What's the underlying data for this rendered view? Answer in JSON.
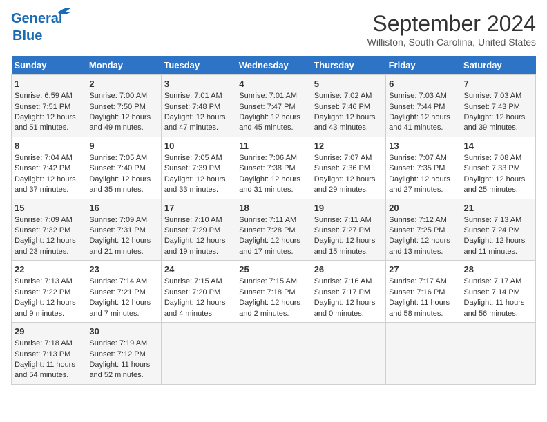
{
  "logo": {
    "line1": "General",
    "line2": "Blue"
  },
  "title": "September 2024",
  "location": "Williston, South Carolina, United States",
  "headers": [
    "Sunday",
    "Monday",
    "Tuesday",
    "Wednesday",
    "Thursday",
    "Friday",
    "Saturday"
  ],
  "weeks": [
    [
      {
        "day": "1",
        "sunrise": "6:59 AM",
        "sunset": "7:51 PM",
        "daylight": "12 hours and 51 minutes."
      },
      {
        "day": "2",
        "sunrise": "7:00 AM",
        "sunset": "7:50 PM",
        "daylight": "12 hours and 49 minutes."
      },
      {
        "day": "3",
        "sunrise": "7:01 AM",
        "sunset": "7:48 PM",
        "daylight": "12 hours and 47 minutes."
      },
      {
        "day": "4",
        "sunrise": "7:01 AM",
        "sunset": "7:47 PM",
        "daylight": "12 hours and 45 minutes."
      },
      {
        "day": "5",
        "sunrise": "7:02 AM",
        "sunset": "7:46 PM",
        "daylight": "12 hours and 43 minutes."
      },
      {
        "day": "6",
        "sunrise": "7:03 AM",
        "sunset": "7:44 PM",
        "daylight": "12 hours and 41 minutes."
      },
      {
        "day": "7",
        "sunrise": "7:03 AM",
        "sunset": "7:43 PM",
        "daylight": "12 hours and 39 minutes."
      }
    ],
    [
      {
        "day": "8",
        "sunrise": "7:04 AM",
        "sunset": "7:42 PM",
        "daylight": "12 hours and 37 minutes."
      },
      {
        "day": "9",
        "sunrise": "7:05 AM",
        "sunset": "7:40 PM",
        "daylight": "12 hours and 35 minutes."
      },
      {
        "day": "10",
        "sunrise": "7:05 AM",
        "sunset": "7:39 PM",
        "daylight": "12 hours and 33 minutes."
      },
      {
        "day": "11",
        "sunrise": "7:06 AM",
        "sunset": "7:38 PM",
        "daylight": "12 hours and 31 minutes."
      },
      {
        "day": "12",
        "sunrise": "7:07 AM",
        "sunset": "7:36 PM",
        "daylight": "12 hours and 29 minutes."
      },
      {
        "day": "13",
        "sunrise": "7:07 AM",
        "sunset": "7:35 PM",
        "daylight": "12 hours and 27 minutes."
      },
      {
        "day": "14",
        "sunrise": "7:08 AM",
        "sunset": "7:33 PM",
        "daylight": "12 hours and 25 minutes."
      }
    ],
    [
      {
        "day": "15",
        "sunrise": "7:09 AM",
        "sunset": "7:32 PM",
        "daylight": "12 hours and 23 minutes."
      },
      {
        "day": "16",
        "sunrise": "7:09 AM",
        "sunset": "7:31 PM",
        "daylight": "12 hours and 21 minutes."
      },
      {
        "day": "17",
        "sunrise": "7:10 AM",
        "sunset": "7:29 PM",
        "daylight": "12 hours and 19 minutes."
      },
      {
        "day": "18",
        "sunrise": "7:11 AM",
        "sunset": "7:28 PM",
        "daylight": "12 hours and 17 minutes."
      },
      {
        "day": "19",
        "sunrise": "7:11 AM",
        "sunset": "7:27 PM",
        "daylight": "12 hours and 15 minutes."
      },
      {
        "day": "20",
        "sunrise": "7:12 AM",
        "sunset": "7:25 PM",
        "daylight": "12 hours and 13 minutes."
      },
      {
        "day": "21",
        "sunrise": "7:13 AM",
        "sunset": "7:24 PM",
        "daylight": "12 hours and 11 minutes."
      }
    ],
    [
      {
        "day": "22",
        "sunrise": "7:13 AM",
        "sunset": "7:22 PM",
        "daylight": "12 hours and 9 minutes."
      },
      {
        "day": "23",
        "sunrise": "7:14 AM",
        "sunset": "7:21 PM",
        "daylight": "12 hours and 7 minutes."
      },
      {
        "day": "24",
        "sunrise": "7:15 AM",
        "sunset": "7:20 PM",
        "daylight": "12 hours and 4 minutes."
      },
      {
        "day": "25",
        "sunrise": "7:15 AM",
        "sunset": "7:18 PM",
        "daylight": "12 hours and 2 minutes."
      },
      {
        "day": "26",
        "sunrise": "7:16 AM",
        "sunset": "7:17 PM",
        "daylight": "12 hours and 0 minutes."
      },
      {
        "day": "27",
        "sunrise": "7:17 AM",
        "sunset": "7:16 PM",
        "daylight": "11 hours and 58 minutes."
      },
      {
        "day": "28",
        "sunrise": "7:17 AM",
        "sunset": "7:14 PM",
        "daylight": "11 hours and 56 minutes."
      }
    ],
    [
      {
        "day": "29",
        "sunrise": "7:18 AM",
        "sunset": "7:13 PM",
        "daylight": "11 hours and 54 minutes."
      },
      {
        "day": "30",
        "sunrise": "7:19 AM",
        "sunset": "7:12 PM",
        "daylight": "11 hours and 52 minutes."
      },
      null,
      null,
      null,
      null,
      null
    ]
  ],
  "labels": {
    "sunrise": "Sunrise:",
    "sunset": "Sunset:",
    "daylight": "Daylight:"
  }
}
